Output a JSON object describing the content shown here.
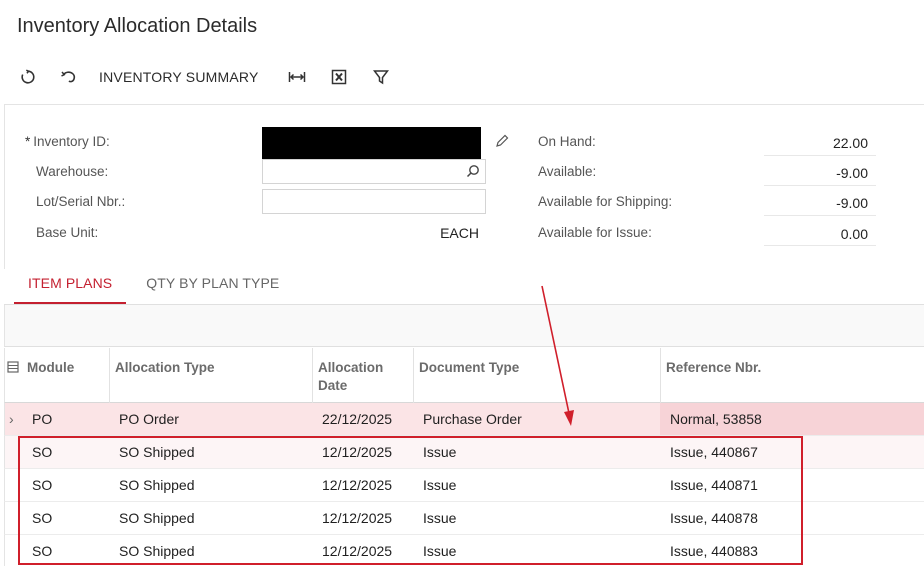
{
  "page": {
    "title": "Inventory Allocation Details"
  },
  "toolbar": {
    "refresh_icon": "refresh-icon",
    "undo_icon": "undo-icon",
    "summary_label": "INVENTORY SUMMARY",
    "fit_icon": "fit-columns-icon",
    "excel_icon": "excel-export-icon",
    "filter_icon": "filter-icon"
  },
  "form": {
    "required_mark": "*",
    "inventory_id_label": "Inventory ID:",
    "warehouse_label": "Warehouse:",
    "lot_serial_label": "Lot/Serial Nbr.:",
    "base_unit_label": "Base Unit:",
    "base_unit_value": "EACH",
    "warehouse_value": "",
    "lot_serial_value": ""
  },
  "summary": {
    "on_hand_label": "On Hand:",
    "on_hand_value": "22.00",
    "available_label": "Available:",
    "available_value": "-9.00",
    "available_shipping_label": "Available for Shipping:",
    "available_shipping_value": "-9.00",
    "available_issue_label": "Available for Issue:",
    "available_issue_value": "0.00"
  },
  "tabs": [
    {
      "label": "ITEM PLANS",
      "active": true
    },
    {
      "label": "QTY BY PLAN TYPE",
      "active": false
    }
  ],
  "grid": {
    "columns": [
      "Module",
      "Allocation Type",
      "Allocation Date",
      "Document Type",
      "Reference Nbr."
    ],
    "rows": [
      {
        "module": "PO",
        "allocation_type": "PO Order",
        "allocation_date": "22/12/2025",
        "document_type": "Purchase Order",
        "reference_nbr": "Normal, 53858"
      },
      {
        "module": "SO",
        "allocation_type": "SO Shipped",
        "allocation_date": "12/12/2025",
        "document_type": "Issue",
        "reference_nbr": "Issue, 440867"
      },
      {
        "module": "SO",
        "allocation_type": "SO Shipped",
        "allocation_date": "12/12/2025",
        "document_type": "Issue",
        "reference_nbr": "Issue, 440871"
      },
      {
        "module": "SO",
        "allocation_type": "SO Shipped",
        "allocation_date": "12/12/2025",
        "document_type": "Issue",
        "reference_nbr": "Issue, 440878"
      },
      {
        "module": "SO",
        "allocation_type": "SO Shipped",
        "allocation_date": "12/12/2025",
        "document_type": "Issue",
        "reference_nbr": "Issue, 440883"
      }
    ]
  },
  "colors": {
    "accent": "#c42030",
    "highlight_row": "#fbe4e6",
    "annotation_red": "#d01f2b"
  }
}
